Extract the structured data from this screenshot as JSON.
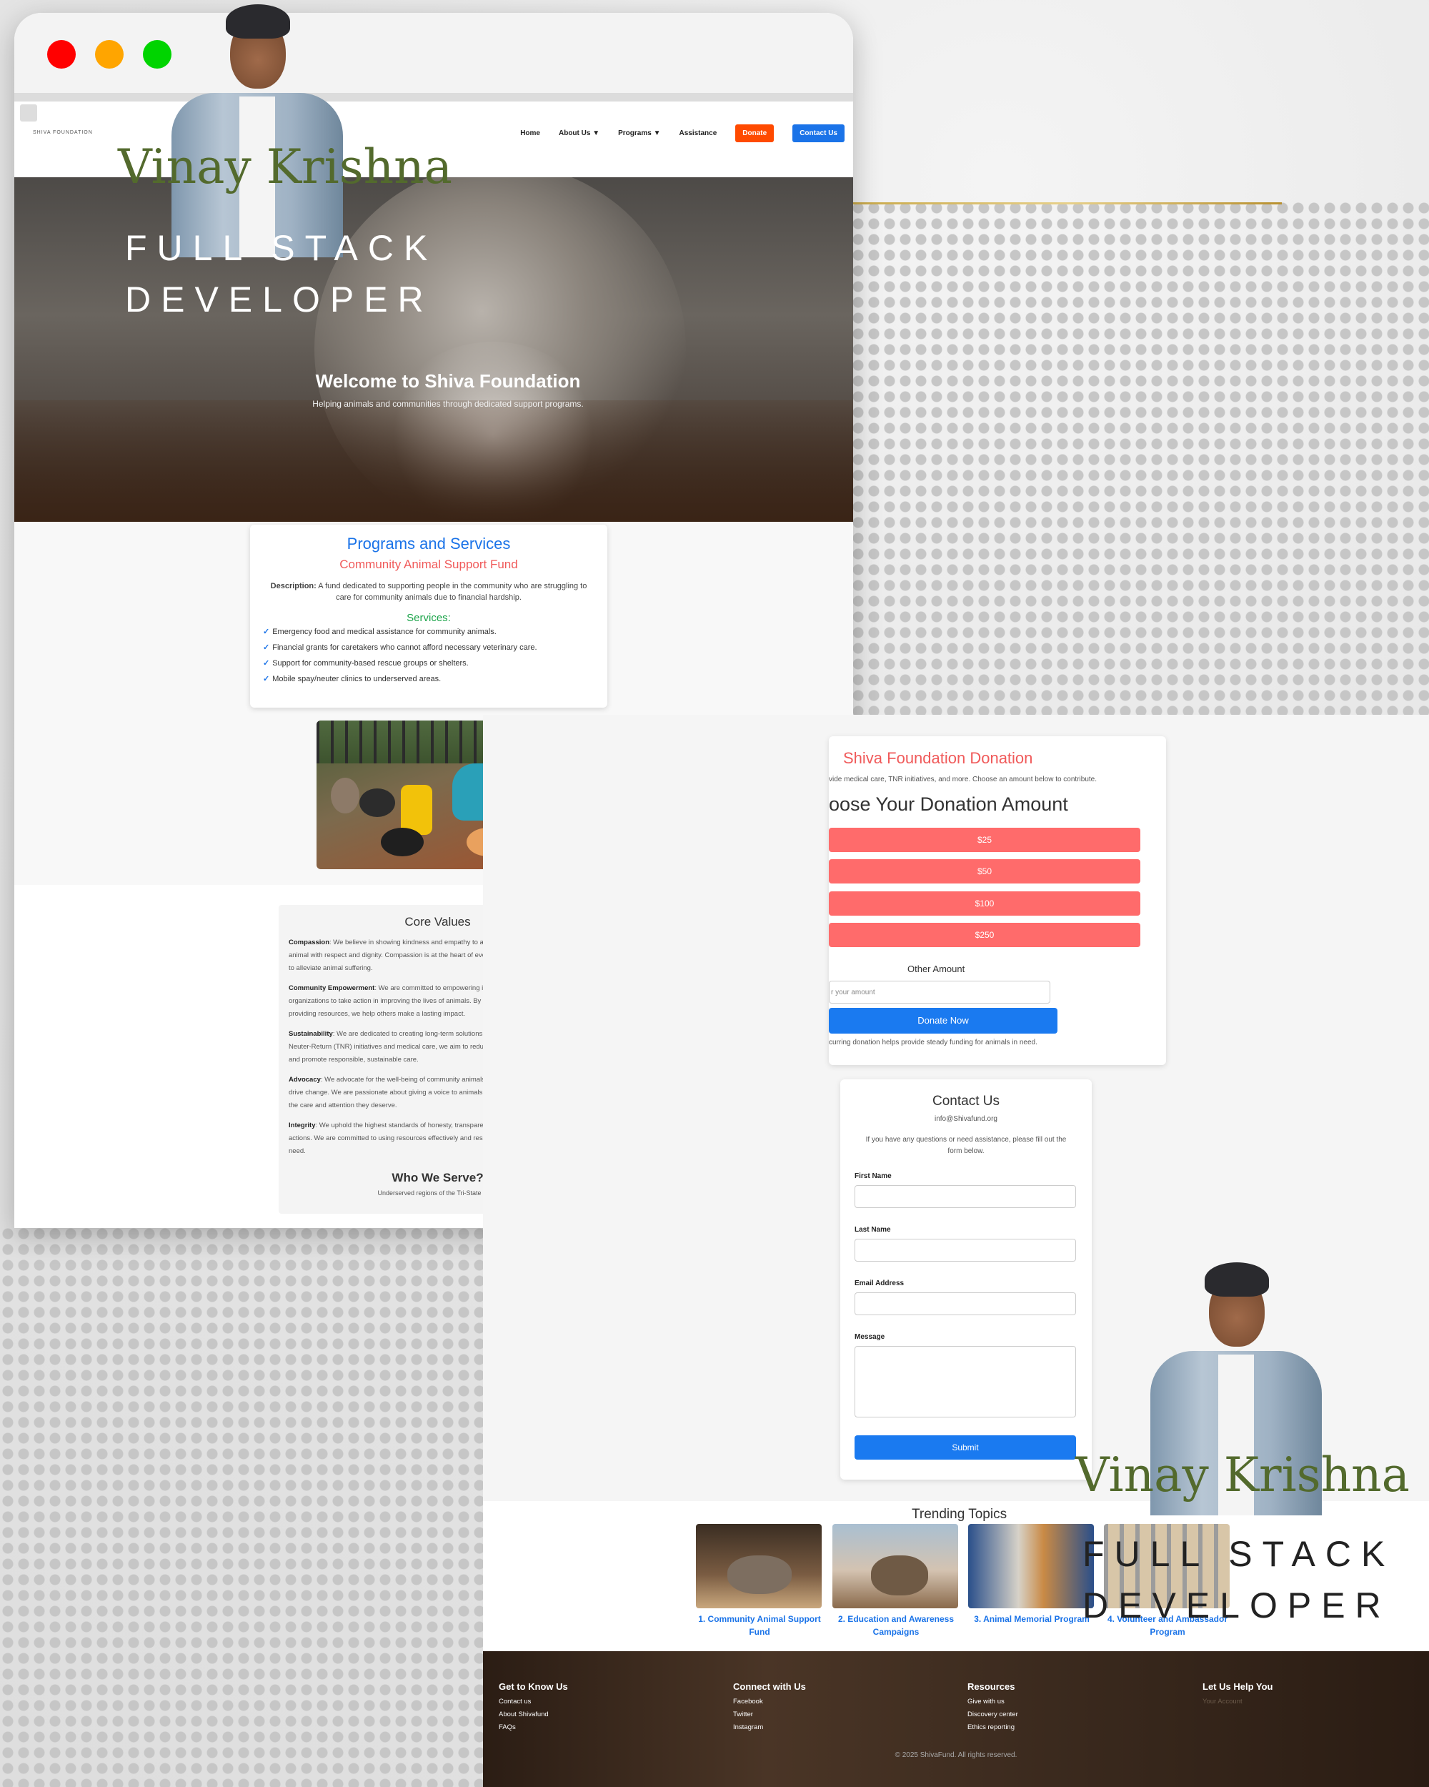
{
  "colors": {
    "accent_blue": "#1a73e8",
    "donate_orange": "#ff4a00",
    "coral": "#f05a5a",
    "green": "#1ca44a",
    "name_olive": "#536a2d"
  },
  "nav": {
    "logo_text": "SHIVA FOUNDATION",
    "links": [
      "Home",
      "About Us ▼",
      "Programs ▼",
      "Assistance"
    ],
    "donate_label": "Donate",
    "contact_label": "Contact Us"
  },
  "hero": {
    "title": "Welcome to Shiva Foundation",
    "subtitle": "Helping animals and communities through dedicated support programs."
  },
  "overlay": {
    "name": "Vinay Krishna",
    "role_line1": "FULL STACK",
    "role_line2": "DEVELOPER"
  },
  "programs": {
    "heading": "Programs and Services",
    "fund_name": "Community Animal Support Fund",
    "desc_label": "Description:",
    "description": "A fund dedicated to supporting people in the community who are struggling to care for community animals due to financial hardship.",
    "services_heading": "Services:",
    "services": [
      "Emergency food and medical assistance for community animals.",
      "Financial grants for caretakers who cannot afford necessary veterinary care.",
      "Support for community-based rescue groups or shelters.",
      "Mobile spay/neuter clinics to underserved areas."
    ]
  },
  "values": {
    "heading": "Core Values",
    "items": [
      {
        "label": "Compassion",
        "text": ": We believe in showing kindness and empathy to all living beings, treating each animal with respect and dignity. Compassion is at the heart of everything we do, driving our efforts to alleviate animal suffering."
      },
      {
        "label": "Community Empowerment",
        "text": ": We are committed to empowering individuals, communities, and organizations to take action in improving the lives of animals. By fostering collaboration and providing resources, we help others make a lasting impact."
      },
      {
        "label": "Sustainability",
        "text": ": We are dedicated to creating long-term solutions for animal welfare. Through Trap-Neuter-Return (TNR) initiatives and medical care, we aim to reduce the number of animals in need and promote responsible, sustainable care."
      },
      {
        "label": "Advocacy",
        "text": ": We advocate for the well-being of community animals, striving to raise awareness and drive change. We are passionate about giving a voice to animals and ensuring that they receive the care and attention they deserve."
      },
      {
        "label": "Integrity",
        "text": ": We uphold the highest standards of honesty, transparency, and accountability in all our actions. We are committed to using resources effectively and responsibly to support animals in need."
      }
    ],
    "who_heading": "Who We Serve?",
    "who_text": "Underserved regions of the Tri-State area!"
  },
  "donation": {
    "title": "Shiva Foundation Donation",
    "subtitle": "vide medical care, TNR initiatives, and more. Choose an amount below to contribute.",
    "choose_heading": "oose Your Donation Amount",
    "amounts": [
      "$25",
      "$50",
      "$100",
      "$250"
    ],
    "other_label": "Other Amount",
    "other_placeholder": "r your amount",
    "donate_now": "Donate Now",
    "recurring": "curring donation helps provide steady funding for animals in need."
  },
  "contact": {
    "title": "Contact Us",
    "email": "info@Shivafund.org",
    "help": "If you have any questions or need assistance, please fill out the form below.",
    "first_name": "First Name",
    "last_name": "Last Name",
    "email_label": "Email Address",
    "message": "Message",
    "submit": "Submit"
  },
  "trending": {
    "title": "Trending Topics",
    "items": [
      "1. Community Animal Support Fund",
      "2. Education and Awareness Campaigns",
      "3. Animal Memorial Program",
      "4. Volunteer and Ambassador Program"
    ]
  },
  "footer": {
    "col1": {
      "heading": "Get to Know Us",
      "links": [
        "Contact us",
        "About Shivafund",
        "FAQs"
      ]
    },
    "col2": {
      "heading": "Connect with Us",
      "links": [
        "Facebook",
        "Twitter",
        "Instagram"
      ]
    },
    "col3": {
      "heading": "Resources",
      "links": [
        "Give with us",
        "Discovery center",
        "Ethics reporting"
      ]
    },
    "col4": {
      "heading": "Let Us Help You",
      "links": [
        "Your Account"
      ]
    },
    "copyright": "© 2025 ShivaFund. All rights reserved."
  }
}
